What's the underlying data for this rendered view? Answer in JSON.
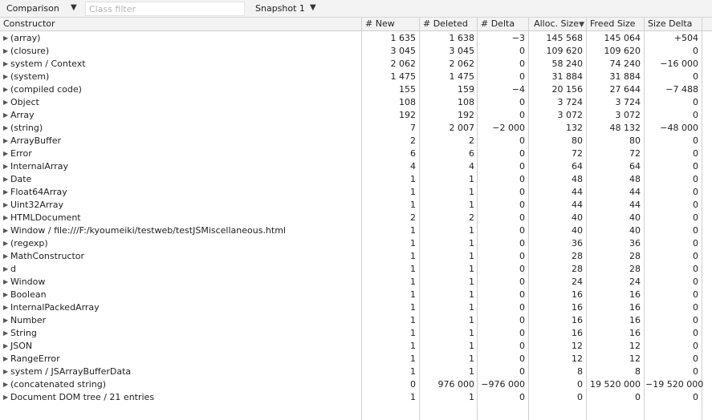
{
  "toolbar": {
    "view_label": "Comparison",
    "view_arrow": "▼",
    "filter_placeholder": "Class filter",
    "snapshot_label": "Snapshot 1",
    "snapshot_arrow": "▼"
  },
  "columns": {
    "constructor": "Constructor",
    "new": "# New",
    "deleted": "# Deleted",
    "delta": "# Delta",
    "alloc": "Alloc. Size",
    "freed": "Freed Size",
    "size_delta": "Size Delta",
    "sort_icon": "sort-descending-icon",
    "sort_glyph": "▼"
  },
  "expand_glyph": "▶",
  "rows": [
    {
      "name": "(array)",
      "new": "1 635",
      "deleted": "1 638",
      "delta": "−3",
      "alloc": "145 568",
      "freed": "145 064",
      "size_delta": "+504"
    },
    {
      "name": "(closure)",
      "new": "3 045",
      "deleted": "3 045",
      "delta": "0",
      "alloc": "109 620",
      "freed": "109 620",
      "size_delta": "0"
    },
    {
      "name": "system / Context",
      "new": "2 062",
      "deleted": "2 062",
      "delta": "0",
      "alloc": "58 240",
      "freed": "74 240",
      "size_delta": "−16 000"
    },
    {
      "name": "(system)",
      "new": "1 475",
      "deleted": "1 475",
      "delta": "0",
      "alloc": "31 884",
      "freed": "31 884",
      "size_delta": "0"
    },
    {
      "name": "(compiled code)",
      "new": "155",
      "deleted": "159",
      "delta": "−4",
      "alloc": "20 156",
      "freed": "27 644",
      "size_delta": "−7 488"
    },
    {
      "name": "Object",
      "new": "108",
      "deleted": "108",
      "delta": "0",
      "alloc": "3 724",
      "freed": "3 724",
      "size_delta": "0"
    },
    {
      "name": "Array",
      "new": "192",
      "deleted": "192",
      "delta": "0",
      "alloc": "3 072",
      "freed": "3 072",
      "size_delta": "0"
    },
    {
      "name": "(string)",
      "new": "7",
      "deleted": "2 007",
      "delta": "−2 000",
      "alloc": "132",
      "freed": "48 132",
      "size_delta": "−48 000"
    },
    {
      "name": "ArrayBuffer",
      "new": "2",
      "deleted": "2",
      "delta": "0",
      "alloc": "80",
      "freed": "80",
      "size_delta": "0"
    },
    {
      "name": "Error",
      "new": "6",
      "deleted": "6",
      "delta": "0",
      "alloc": "72",
      "freed": "72",
      "size_delta": "0"
    },
    {
      "name": "InternalArray",
      "new": "4",
      "deleted": "4",
      "delta": "0",
      "alloc": "64",
      "freed": "64",
      "size_delta": "0"
    },
    {
      "name": "Date",
      "new": "1",
      "deleted": "1",
      "delta": "0",
      "alloc": "48",
      "freed": "48",
      "size_delta": "0"
    },
    {
      "name": "Float64Array",
      "new": "1",
      "deleted": "1",
      "delta": "0",
      "alloc": "44",
      "freed": "44",
      "size_delta": "0"
    },
    {
      "name": "Uint32Array",
      "new": "1",
      "deleted": "1",
      "delta": "0",
      "alloc": "44",
      "freed": "44",
      "size_delta": "0"
    },
    {
      "name": "HTMLDocument",
      "new": "2",
      "deleted": "2",
      "delta": "0",
      "alloc": "40",
      "freed": "40",
      "size_delta": "0"
    },
    {
      "name": "Window / file:///F:/kyoumeiki/testweb/testJSMiscellaneous.html",
      "new": "1",
      "deleted": "1",
      "delta": "0",
      "alloc": "40",
      "freed": "40",
      "size_delta": "0"
    },
    {
      "name": "(regexp)",
      "new": "1",
      "deleted": "1",
      "delta": "0",
      "alloc": "36",
      "freed": "36",
      "size_delta": "0"
    },
    {
      "name": "MathConstructor",
      "new": "1",
      "deleted": "1",
      "delta": "0",
      "alloc": "28",
      "freed": "28",
      "size_delta": "0"
    },
    {
      "name": "d",
      "new": "1",
      "deleted": "1",
      "delta": "0",
      "alloc": "28",
      "freed": "28",
      "size_delta": "0"
    },
    {
      "name": "Window",
      "new": "1",
      "deleted": "1",
      "delta": "0",
      "alloc": "24",
      "freed": "24",
      "size_delta": "0"
    },
    {
      "name": "Boolean",
      "new": "1",
      "deleted": "1",
      "delta": "0",
      "alloc": "16",
      "freed": "16",
      "size_delta": "0"
    },
    {
      "name": "InternalPackedArray",
      "new": "1",
      "deleted": "1",
      "delta": "0",
      "alloc": "16",
      "freed": "16",
      "size_delta": "0"
    },
    {
      "name": "Number",
      "new": "1",
      "deleted": "1",
      "delta": "0",
      "alloc": "16",
      "freed": "16",
      "size_delta": "0"
    },
    {
      "name": "String",
      "new": "1",
      "deleted": "1",
      "delta": "0",
      "alloc": "16",
      "freed": "16",
      "size_delta": "0"
    },
    {
      "name": "JSON",
      "new": "1",
      "deleted": "1",
      "delta": "0",
      "alloc": "12",
      "freed": "12",
      "size_delta": "0"
    },
    {
      "name": "RangeError",
      "new": "1",
      "deleted": "1",
      "delta": "0",
      "alloc": "12",
      "freed": "12",
      "size_delta": "0"
    },
    {
      "name": "system / JSArrayBufferData",
      "new": "1",
      "deleted": "1",
      "delta": "0",
      "alloc": "8",
      "freed": "8",
      "size_delta": "0"
    },
    {
      "name": "(concatenated string)",
      "new": "0",
      "deleted": "976 000",
      "delta": "−976 000",
      "alloc": "0",
      "freed": "19 520 000",
      "size_delta": "−19 520 000"
    },
    {
      "name": "Document DOM tree / 21 entries",
      "new": "1",
      "deleted": "1",
      "delta": "0",
      "alloc": "0",
      "freed": "0",
      "size_delta": "0"
    }
  ]
}
